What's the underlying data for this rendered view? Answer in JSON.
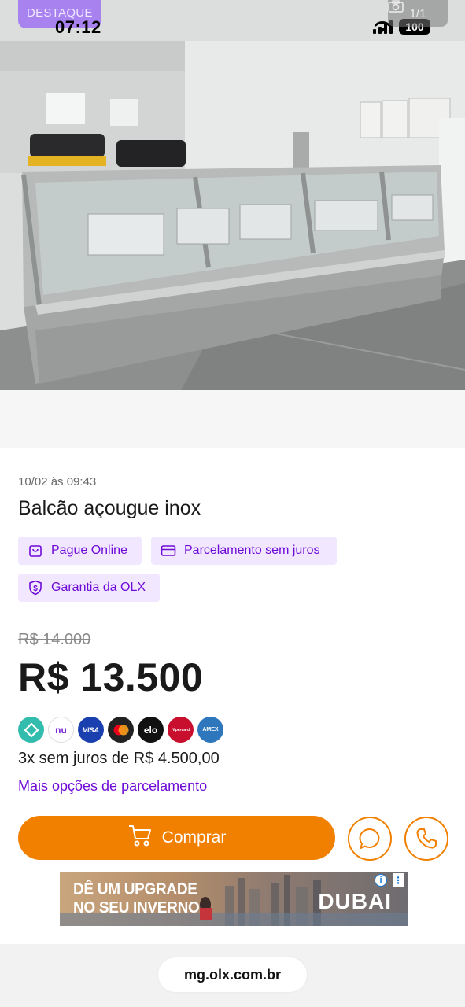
{
  "status_bar": {
    "time": "07:12",
    "battery": "100"
  },
  "photo": {
    "badge": "DESTAQUE",
    "counter": "1/1"
  },
  "listing": {
    "date": "10/02 às 09:43",
    "title": "Balcão açougue inox",
    "tags": [
      {
        "label": "Pague Online",
        "icon": "shopping-bag-icon"
      },
      {
        "label": "Parcelamento sem juros",
        "icon": "credit-card-icon"
      },
      {
        "label": "Garantia da OLX",
        "icon": "shield-dollar-icon"
      }
    ],
    "old_price": "R$ 14.000",
    "price": "R$ 13.500",
    "payment_methods": [
      {
        "name": "pix-icon",
        "color": "#32bcad"
      },
      {
        "name": "nubank-icon",
        "label": "nu",
        "color": "#ffffff"
      },
      {
        "name": "visa-icon",
        "label": "VISA",
        "color": "#1a3fae"
      },
      {
        "name": "mastercard-icon",
        "color": "#222222"
      },
      {
        "name": "elo-icon",
        "label": "elo",
        "color": "#111111"
      },
      {
        "name": "hipercard-icon",
        "label": "Hipercard",
        "color": "#c8102e"
      },
      {
        "name": "amex-icon",
        "label": "AMEX",
        "color": "#2e77bc"
      }
    ],
    "installments": "3x sem juros de R$ 4.500,00",
    "more_options": "Mais opções de parcelamento"
  },
  "actions": {
    "buy_label": "Comprar",
    "buy_icon": "cart-icon",
    "chat_icon": "chat-icon",
    "phone_icon": "phone-icon",
    "accent_color": "#f28000"
  },
  "ad": {
    "headline_1": "DÊ UM UPGRADE",
    "headline_2": "NO SEU INVERNO",
    "brand": "DUBAI"
  },
  "browser": {
    "url": "mg.olx.com.br"
  }
}
